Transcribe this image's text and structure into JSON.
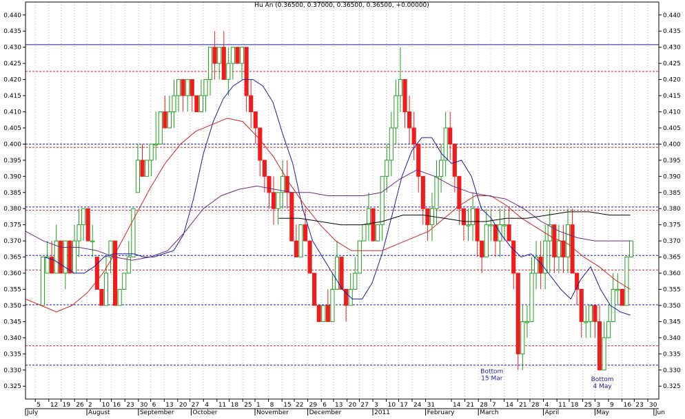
{
  "chart_data": {
    "type": "candlestick",
    "title": "Hu An (0.36500, 0.37000, 0.36500, 0.36500, +0.00000)",
    "ylim": [
      0.321,
      0.444
    ],
    "y_ticks": [
      "0.440",
      "0.435",
      "0.430",
      "0.425",
      "0.420",
      "0.415",
      "0.410",
      "0.405",
      "0.400",
      "0.395",
      "0.390",
      "0.385",
      "0.380",
      "0.375",
      "0.370",
      "0.365",
      "0.360",
      "0.355",
      "0.350",
      "0.345",
      "0.340",
      "0.335",
      "0.330",
      "0.325"
    ],
    "x_day_ticks": [
      {
        "label": "5",
        "pos": 0.0
      },
      {
        "label": "12",
        "pos": 5.5
      },
      {
        "label": "19",
        "pos": 10.5
      },
      {
        "label": "26",
        "pos": 16.0
      },
      {
        "label": "2",
        "pos": 21.0
      },
      {
        "label": "10",
        "pos": 26.5
      },
      {
        "label": "16",
        "pos": 31.0
      },
      {
        "label": "23",
        "pos": 36.5
      },
      {
        "label": "30",
        "pos": 42.0
      },
      {
        "label": "6",
        "pos": 47.0
      },
      {
        "label": "13",
        "pos": 52.5
      },
      {
        "label": "20",
        "pos": 58.0
      },
      {
        "label": "27",
        "pos": 63.0
      },
      {
        "label": "4",
        "pos": 68.5
      },
      {
        "label": "11",
        "pos": 74.0
      },
      {
        "label": "18",
        "pos": 79.0
      },
      {
        "label": "25",
        "pos": 84.5
      },
      {
        "label": "1",
        "pos": 89.5
      },
      {
        "label": "8",
        "pos": 95.0
      },
      {
        "label": "15",
        "pos": 100.5
      },
      {
        "label": "22",
        "pos": 105.5
      },
      {
        "label": "29",
        "pos": 111.0
      },
      {
        "label": "6",
        "pos": 116.5
      },
      {
        "label": "13",
        "pos": 121.5
      },
      {
        "label": "20",
        "pos": 127.0
      },
      {
        "label": "27",
        "pos": 132.0
      },
      {
        "label": "3",
        "pos": 137.5
      },
      {
        "label": "10",
        "pos": 143.0
      },
      {
        "label": "17",
        "pos": 148.0
      },
      {
        "label": "24",
        "pos": 153.5
      },
      {
        "label": "31",
        "pos": 159.0
      },
      {
        "label": "14",
        "pos": 169.5
      },
      {
        "label": "21",
        "pos": 175.0
      },
      {
        "label": "28",
        "pos": 180.5
      },
      {
        "label": "7",
        "pos": 185.5
      },
      {
        "label": "14",
        "pos": 191.0
      },
      {
        "label": "21",
        "pos": 196.5
      },
      {
        "label": "28",
        "pos": 201.5
      },
      {
        "label": "4",
        "pos": 207.0
      },
      {
        "label": "11",
        "pos": 212.5
      },
      {
        "label": "18",
        "pos": 217.5
      },
      {
        "label": "25",
        "pos": 223.0
      },
      {
        "label": "3",
        "pos": 228.0
      },
      {
        "label": "9",
        "pos": 233.5
      },
      {
        "label": "16",
        "pos": 239.0
      },
      {
        "label": "23",
        "pos": 244.0
      },
      {
        "label": "30",
        "pos": 249.5
      }
    ],
    "x_months": [
      {
        "label": "July",
        "pos": -4.0
      },
      {
        "label": "August",
        "pos": 21.0
      },
      {
        "label": "September",
        "pos": 42.0
      },
      {
        "label": "October",
        "pos": 63.5
      },
      {
        "label": "November",
        "pos": 89.5
      },
      {
        "label": "December",
        "pos": 111.0
      },
      {
        "label": "2011",
        "pos": 137.5
      },
      {
        "label": "February",
        "pos": 159.0
      },
      {
        "label": "March",
        "pos": 180.5
      },
      {
        "label": "April",
        "pos": 207.0
      },
      {
        "label": "May",
        "pos": 228.0
      },
      {
        "label": "Jun",
        "pos": 252.0
      }
    ],
    "x_range": [
      -4.0,
      254.0
    ],
    "bars": [
      [
        0.35,
        0.365,
        0.35,
        0.365
      ],
      [
        0.36,
        0.37,
        0.36,
        0.365
      ],
      [
        0.365,
        0.37,
        0.36,
        0.36
      ],
      [
        0.36,
        0.375,
        0.36,
        0.37
      ],
      [
        0.37,
        0.37,
        0.36,
        0.36
      ],
      [
        0.36,
        0.37,
        0.355,
        0.37
      ],
      [
        0.37,
        0.37,
        0.36,
        0.36
      ],
      [
        0.36,
        0.375,
        0.36,
        0.37
      ],
      [
        0.37,
        0.38,
        0.365,
        0.375
      ],
      [
        0.375,
        0.38,
        0.37,
        0.38
      ],
      [
        0.38,
        0.38,
        0.37,
        0.37
      ],
      [
        0.37,
        0.375,
        0.365,
        0.37
      ],
      [
        0.365,
        0.365,
        0.355,
        0.355
      ],
      [
        0.355,
        0.355,
        0.35,
        0.35
      ],
      [
        0.35,
        0.365,
        0.35,
        0.36
      ],
      [
        0.365,
        0.37,
        0.36,
        0.37
      ],
      [
        0.37,
        0.37,
        0.35,
        0.35
      ],
      [
        0.35,
        0.355,
        0.35,
        0.355
      ],
      [
        0.355,
        0.36,
        0.355,
        0.36
      ],
      [
        0.36,
        0.37,
        0.36,
        0.365
      ],
      [
        0.365,
        0.38,
        0.365,
        0.38
      ],
      [
        0.385,
        0.4,
        0.385,
        0.395
      ],
      [
        0.395,
        0.4,
        0.39,
        0.39
      ],
      [
        0.39,
        0.395,
        0.39,
        0.395
      ],
      [
        0.395,
        0.4,
        0.39,
        0.4
      ],
      [
        0.4,
        0.41,
        0.395,
        0.4
      ],
      [
        0.4,
        0.41,
        0.4,
        0.41
      ],
      [
        0.41,
        0.415,
        0.405,
        0.405
      ],
      [
        0.405,
        0.415,
        0.405,
        0.41
      ],
      [
        0.41,
        0.42,
        0.405,
        0.415
      ],
      [
        0.415,
        0.42,
        0.41,
        0.42
      ],
      [
        0.42,
        0.42,
        0.41,
        0.415
      ],
      [
        0.415,
        0.42,
        0.41,
        0.42
      ],
      [
        0.42,
        0.42,
        0.41,
        0.415
      ],
      [
        0.415,
        0.415,
        0.41,
        0.41
      ],
      [
        0.41,
        0.42,
        0.41,
        0.415
      ],
      [
        0.415,
        0.42,
        0.41,
        0.42
      ],
      [
        0.42,
        0.43,
        0.415,
        0.43
      ],
      [
        0.43,
        0.435,
        0.42,
        0.425
      ],
      [
        0.425,
        0.43,
        0.42,
        0.43
      ],
      [
        0.43,
        0.435,
        0.42,
        0.42
      ],
      [
        0.42,
        0.43,
        0.415,
        0.425
      ],
      [
        0.425,
        0.43,
        0.42,
        0.43
      ],
      [
        0.43,
        0.43,
        0.425,
        0.425
      ],
      [
        0.425,
        0.43,
        0.42,
        0.43
      ],
      [
        0.43,
        0.43,
        0.41,
        0.415
      ],
      [
        0.415,
        0.42,
        0.405,
        0.41
      ],
      [
        0.41,
        0.41,
        0.4,
        0.405
      ],
      [
        0.405,
        0.405,
        0.39,
        0.395
      ],
      [
        0.395,
        0.395,
        0.385,
        0.39
      ],
      [
        0.39,
        0.39,
        0.38,
        0.385
      ],
      [
        0.385,
        0.39,
        0.375,
        0.38
      ],
      [
        0.38,
        0.385,
        0.375,
        0.385
      ],
      [
        0.385,
        0.395,
        0.38,
        0.39
      ],
      [
        0.39,
        0.395,
        0.38,
        0.385
      ],
      [
        0.385,
        0.385,
        0.37,
        0.37
      ],
      [
        0.37,
        0.375,
        0.365,
        0.365
      ],
      [
        0.365,
        0.375,
        0.365,
        0.375
      ],
      [
        0.375,
        0.38,
        0.37,
        0.37
      ],
      [
        0.37,
        0.37,
        0.36,
        0.36
      ],
      [
        0.36,
        0.36,
        0.35,
        0.35
      ],
      [
        0.35,
        0.35,
        0.345,
        0.345
      ],
      [
        0.345,
        0.35,
        0.345,
        0.35
      ],
      [
        0.35,
        0.355,
        0.345,
        0.345
      ],
      [
        0.345,
        0.36,
        0.345,
        0.355
      ],
      [
        0.355,
        0.37,
        0.355,
        0.365
      ],
      [
        0.365,
        0.365,
        0.355,
        0.355
      ],
      [
        0.355,
        0.355,
        0.345,
        0.35
      ],
      [
        0.35,
        0.36,
        0.35,
        0.355
      ],
      [
        0.355,
        0.365,
        0.355,
        0.36
      ],
      [
        0.36,
        0.37,
        0.36,
        0.37
      ],
      [
        0.37,
        0.375,
        0.37,
        0.375
      ],
      [
        0.375,
        0.385,
        0.37,
        0.38
      ],
      [
        0.38,
        0.38,
        0.37,
        0.37
      ],
      [
        0.37,
        0.375,
        0.37,
        0.375
      ],
      [
        0.375,
        0.39,
        0.37,
        0.39
      ],
      [
        0.39,
        0.4,
        0.385,
        0.395
      ],
      [
        0.395,
        0.41,
        0.39,
        0.405
      ],
      [
        0.405,
        0.42,
        0.4,
        0.415
      ],
      [
        0.415,
        0.43,
        0.41,
        0.42
      ],
      [
        0.42,
        0.42,
        0.405,
        0.41
      ],
      [
        0.41,
        0.415,
        0.4,
        0.405
      ],
      [
        0.405,
        0.41,
        0.395,
        0.4
      ],
      [
        0.4,
        0.4,
        0.385,
        0.39
      ],
      [
        0.39,
        0.39,
        0.375,
        0.38
      ],
      [
        0.38,
        0.38,
        0.37,
        0.375
      ],
      [
        0.375,
        0.385,
        0.37,
        0.38
      ],
      [
        0.38,
        0.395,
        0.375,
        0.39
      ],
      [
        0.39,
        0.4,
        0.385,
        0.395
      ],
      [
        0.395,
        0.41,
        0.39,
        0.405
      ],
      [
        0.405,
        0.41,
        0.395,
        0.4
      ],
      [
        0.4,
        0.4,
        0.385,
        0.39
      ],
      [
        0.39,
        0.39,
        0.375,
        0.38
      ],
      [
        0.38,
        0.38,
        0.37,
        0.375
      ],
      [
        0.375,
        0.38,
        0.37,
        0.375
      ],
      [
        0.375,
        0.385,
        0.37,
        0.38
      ],
      [
        0.38,
        0.38,
        0.365,
        0.37
      ],
      [
        0.37,
        0.37,
        0.36,
        0.365
      ],
      [
        0.365,
        0.38,
        0.365,
        0.375
      ],
      [
        0.375,
        0.38,
        0.37,
        0.375
      ],
      [
        0.375,
        0.375,
        0.365,
        0.37
      ],
      [
        0.37,
        0.38,
        0.365,
        0.375
      ],
      [
        0.375,
        0.38,
        0.37,
        0.375
      ],
      [
        0.375,
        0.38,
        0.37,
        0.37
      ],
      [
        0.37,
        0.37,
        0.355,
        0.36
      ],
      [
        0.36,
        0.36,
        0.33,
        0.335
      ],
      [
        0.335,
        0.35,
        0.33,
        0.345
      ],
      [
        0.345,
        0.35,
        0.34,
        0.345
      ],
      [
        0.345,
        0.365,
        0.345,
        0.36
      ],
      [
        0.36,
        0.37,
        0.355,
        0.365
      ],
      [
        0.365,
        0.37,
        0.355,
        0.36
      ],
      [
        0.36,
        0.375,
        0.355,
        0.37
      ],
      [
        0.37,
        0.38,
        0.36,
        0.375
      ],
      [
        0.375,
        0.375,
        0.36,
        0.365
      ],
      [
        0.365,
        0.375,
        0.36,
        0.37
      ],
      [
        0.37,
        0.375,
        0.36,
        0.365
      ],
      [
        0.365,
        0.38,
        0.36,
        0.375
      ],
      [
        0.375,
        0.38,
        0.36,
        0.36
      ],
      [
        0.36,
        0.36,
        0.35,
        0.355
      ],
      [
        0.355,
        0.355,
        0.34,
        0.345
      ],
      [
        0.345,
        0.35,
        0.34,
        0.345
      ],
      [
        0.345,
        0.35,
        0.34,
        0.35
      ],
      [
        0.35,
        0.35,
        0.34,
        0.345
      ],
      [
        0.345,
        0.35,
        0.33,
        0.33
      ],
      [
        0.33,
        0.345,
        0.33,
        0.34
      ],
      [
        0.34,
        0.35,
        0.34,
        0.345
      ],
      [
        0.345,
        0.36,
        0.345,
        0.355
      ],
      [
        0.355,
        0.36,
        0.35,
        0.355
      ],
      [
        0.355,
        0.355,
        0.35,
        0.35
      ],
      [
        0.35,
        0.365,
        0.35,
        0.365
      ],
      [
        0.365,
        0.37,
        0.365,
        0.37
      ]
    ],
    "sma_blue": [
      0.365,
      0.364,
      0.362,
      0.36,
      0.36,
      0.362,
      0.365,
      0.366,
      0.366,
      0.366,
      0.365,
      0.365,
      0.366,
      0.367,
      0.372,
      0.383,
      0.397,
      0.407,
      0.414,
      0.418,
      0.42,
      0.42,
      0.418,
      0.413,
      0.403,
      0.394,
      0.38,
      0.37,
      0.365,
      0.36,
      0.355,
      0.352,
      0.352,
      0.357,
      0.366,
      0.378,
      0.39,
      0.398,
      0.402,
      0.402,
      0.397,
      0.394,
      0.395,
      0.39,
      0.38,
      0.377,
      0.372,
      0.368,
      0.365,
      0.366,
      0.363,
      0.359,
      0.355,
      0.352,
      0.358,
      0.362,
      0.355,
      0.35,
      0.348,
      0.347
    ],
    "sma_red": [
      0.352,
      0.35,
      0.348,
      0.35,
      0.354,
      0.36,
      0.368,
      0.377,
      0.386,
      0.394,
      0.4,
      0.404,
      0.406,
      0.408,
      0.407,
      0.402,
      0.396,
      0.388,
      0.381,
      0.375,
      0.37,
      0.367,
      0.367,
      0.367,
      0.369,
      0.371,
      0.373,
      0.377,
      0.381,
      0.384,
      0.384,
      0.381,
      0.377,
      0.374,
      0.371,
      0.369,
      0.365,
      0.362,
      0.358,
      0.355
    ],
    "sma_purple": [
      0.373,
      0.37,
      0.368,
      0.368,
      0.367,
      0.365,
      0.364,
      0.365,
      0.367,
      0.373,
      0.38,
      0.384,
      0.386,
      0.387,
      0.386,
      0.385,
      0.385,
      0.384,
      0.384,
      0.384,
      0.385,
      0.389,
      0.392,
      0.39,
      0.387,
      0.385,
      0.384,
      0.383,
      0.38,
      0.376,
      0.373,
      0.371,
      0.37,
      0.37,
      0.37
    ],
    "sma_black": [
      0.377,
      0.377,
      0.376,
      0.375,
      0.375,
      0.376,
      0.378,
      0.378,
      0.377,
      0.376,
      0.376,
      0.377,
      0.377,
      0.378,
      0.379,
      0.379,
      0.378,
      0.378
    ],
    "h_lines": [
      {
        "y": 0.4308,
        "style": "solid",
        "color": "#1a1aa0"
      },
      {
        "y": 0.4225,
        "style": "dashed",
        "color": "#c82828"
      },
      {
        "y": 0.4,
        "style": "dashed",
        "color": "#1a1aa0"
      },
      {
        "y": 0.399,
        "style": "dashed",
        "color": "#c82828"
      },
      {
        "y": 0.3805,
        "style": "dashed",
        "color": "#1a1aa0"
      },
      {
        "y": 0.3795,
        "style": "dashed",
        "color": "#c82828"
      },
      {
        "y": 0.3655,
        "style": "dashed",
        "color": "#1a1aa0"
      },
      {
        "y": 0.361,
        "style": "dashed",
        "color": "#c82828"
      },
      {
        "y": 0.3502,
        "style": "dashed",
        "color": "#1a1aa0"
      },
      {
        "y": 0.3375,
        "style": "dashed",
        "color": "#c82828"
      },
      {
        "y": 0.3315,
        "style": "dashed",
        "color": "#1a1aa0"
      }
    ],
    "annotations": [
      {
        "lines": [
          "Bottom",
          "15 Mar"
        ],
        "x": 186.0,
        "y": 0.329
      },
      {
        "lines": [
          "Bottom",
          "4 May"
        ],
        "x": 231.0,
        "y": 0.3265
      }
    ],
    "colors": {
      "up": "#1e9e1e",
      "down": "#ee1c1c",
      "blue": "#1a1aa0",
      "red": "#d42020",
      "purple": "#6a2a7a",
      "black": "#000000",
      "grid": "#b8b8b8",
      "axis": "#000000"
    }
  }
}
